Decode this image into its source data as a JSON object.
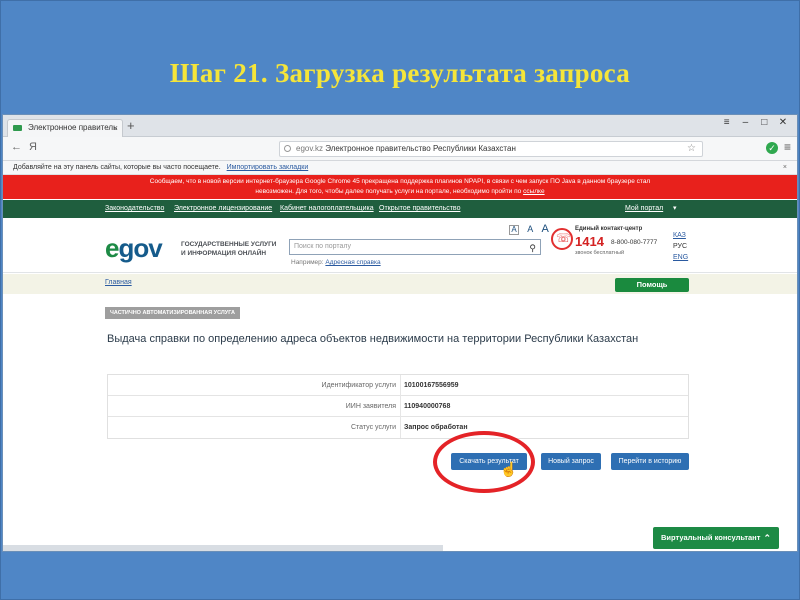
{
  "slide": {
    "title": "Шаг 21. Загрузка результата запроса"
  },
  "browser": {
    "tab_title": "Электронное правитель",
    "tab_close": "×",
    "new_tab": "+",
    "win_controls": [
      "≡",
      "‒",
      "□",
      "✕"
    ],
    "back": "←",
    "forward": "Я",
    "url_domain": "egov.kz",
    "url_title": "Электронное правительство Республики Казахстан",
    "bookmarks_text": "Добавляйте на эту панель сайты, которые вы часто посещаете.",
    "bookmarks_link": "Импортировать закладки",
    "bookmarks_close": "×"
  },
  "warning": {
    "line1": "Сообщаем, что в новой версии интернет-браузера Google Chrome 45 прекращена поддержка плагинов NPAPI, в связи с чем запуск ПО Java в данном браузере стал",
    "line2": "невозможен. Для того, чтобы далее получать услуги на портале, необходимо пройти по",
    "link": "ссылке"
  },
  "nav": {
    "items": [
      "Законодательство",
      "Электронное лицензирование",
      "Кабинет налогоплательщика",
      "Открытое правительство"
    ],
    "my_portal": "Мой портал"
  },
  "header": {
    "logo_e": "e",
    "logo_rest": "gov",
    "logo_text_line1": "ГОСУДАРСТВЕННЫЕ УСЛУГИ",
    "logo_text_line2": "И ИНФОРМАЦИЯ ОНЛАЙН",
    "search_placeholder": "Поиск по порталу",
    "example_label": "Например:",
    "example_link": "Адресная справка",
    "font_sizes": [
      "A",
      "A",
      "A"
    ],
    "contact_title": "Единый контакт-центр",
    "contact_number": "1414",
    "contact_alt": "8-800-080-7777",
    "contact_free": "звонок бесплатный",
    "langs": [
      "КАЗ",
      "РУС",
      "ENG"
    ]
  },
  "breadcrumb": "Главная",
  "help_button": "Помощь",
  "badge": "ЧАСТИЧНО АВТОМАТИЗИРОВАННАЯ УСЛУГА",
  "service_title": "Выдача справки по определению адреса объектов недвижимости на территории Республики Казахстан",
  "info_rows": [
    {
      "label": "Идентификатор услуги",
      "value": "10100167556959"
    },
    {
      "label": "ИИН заявителя",
      "value": "110940000768"
    },
    {
      "label": "Статус услуги",
      "value": "Запрос обработан"
    }
  ],
  "buttons": {
    "download": "Скачать результат",
    "new_request": "Новый запрос",
    "history": "Перейти в историю"
  },
  "consultant": {
    "label": "Виртуальный консультант",
    "chevron": "⌃"
  }
}
